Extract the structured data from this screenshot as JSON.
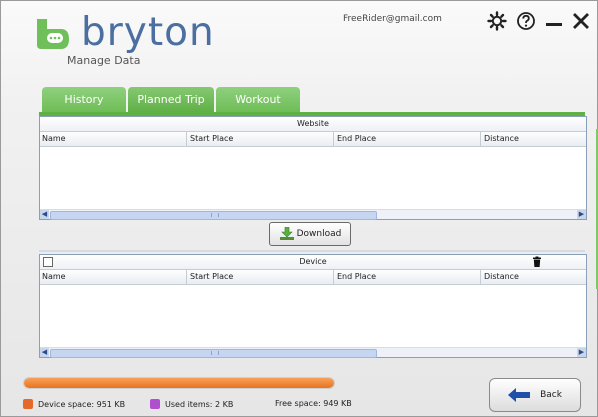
{
  "header": {
    "brand": "bryton",
    "subtitle": "Manage Data",
    "account_email": "FreeRider@gmail.com"
  },
  "window_controls": [
    {
      "icon": "gear-icon"
    },
    {
      "icon": "help-icon"
    },
    {
      "icon": "minimize-icon"
    },
    {
      "icon": "close-icon"
    }
  ],
  "tabs": [
    {
      "label": "History",
      "active": false
    },
    {
      "label": "Planned Trip",
      "active": true
    },
    {
      "label": "Workout",
      "active": false
    }
  ],
  "website_table": {
    "title": "Website",
    "columns": [
      "Name",
      "Start Place",
      "End Place",
      "Distance"
    ],
    "rows": []
  },
  "download_button": {
    "label": "Download",
    "icon": "download-arrow-icon"
  },
  "device_table": {
    "title": "Device",
    "columns": [
      "Name",
      "Start Place",
      "End Place",
      "Distance"
    ],
    "rows": [],
    "select_all_checked": false,
    "delete_icon": "trash-icon"
  },
  "storage": {
    "usage_fraction": 1.0,
    "device_space_label": "Device space: 951 KB",
    "used_items_label": "Used items: 2 KB",
    "free_space_label": "Free space: 949 KB",
    "colors": {
      "device_space": "#e9731f",
      "used_items": "#b04fd0",
      "accent_green": "#6fbd57",
      "brand_blue": "#4a6fa0"
    }
  },
  "back_button": {
    "label": "Back",
    "icon": "back-arrow-icon"
  }
}
